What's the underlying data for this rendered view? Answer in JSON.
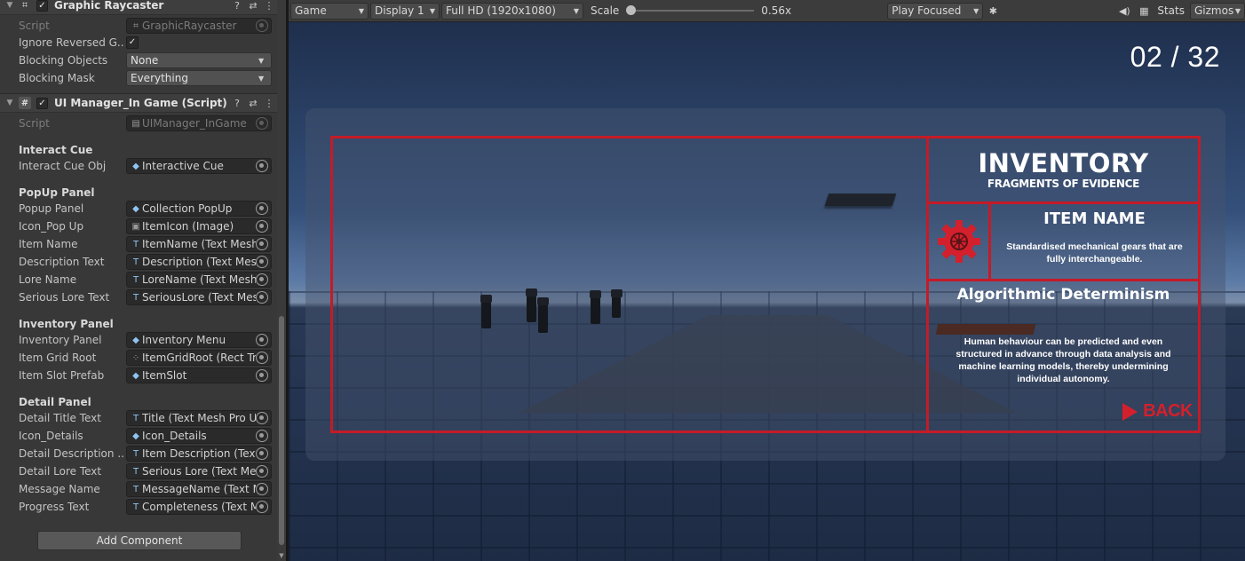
{
  "colors": {
    "accent_red": "#c41b27",
    "inspector_bg": "#383838",
    "object_icon": "#8fc4f2"
  },
  "inspector": {
    "graphic_raycaster": {
      "title": "Graphic Raycaster",
      "script_label": "Script",
      "script_value": "GraphicRaycaster",
      "ignore_reversed_label": "Ignore Reversed G...",
      "ignore_reversed_checked": "✓",
      "blocking_objects_label": "Blocking Objects",
      "blocking_objects_value": "None",
      "blocking_mask_label": "Blocking Mask",
      "blocking_mask_value": "Everything"
    },
    "ui_manager": {
      "title": "UI Manager_In Game (Script)",
      "enabled": "✓",
      "script_label": "Script",
      "script_value": "UIManager_InGame"
    },
    "sections": {
      "interact_cue": "Interact Cue",
      "popup_panel": "PopUp Panel",
      "inventory_panel": "Inventory Panel",
      "detail_panel": "Detail Panel"
    },
    "fields": {
      "interact_cue_obj": {
        "label": "Interact Cue Obj",
        "value": "Interactive Cue"
      },
      "popup_panel": {
        "label": "Popup Panel",
        "value": "Collection PopUp"
      },
      "icon_pop_up": {
        "label": "Icon_Pop Up",
        "value": "ItemIcon (Image)"
      },
      "item_name": {
        "label": "Item Name",
        "value": "ItemName (Text Mesh"
      },
      "description_text": {
        "label": "Description Text",
        "value": "Description (Text Mesh"
      },
      "lore_name": {
        "label": "Lore Name",
        "value": "LoreName (Text Mesh"
      },
      "serious_lore_text": {
        "label": "Serious Lore Text",
        "value": "SeriousLore (Text Mesh"
      },
      "inventory_panel": {
        "label": "Inventory Panel",
        "value": "Inventory Menu"
      },
      "item_grid_root": {
        "label": "Item Grid Root",
        "value": "ItemGridRoot (Rect Tra"
      },
      "item_slot_prefab": {
        "label": "Item Slot Prefab",
        "value": "ItemSlot"
      },
      "detail_title_text": {
        "label": "Detail Title Text",
        "value": "Title (Text Mesh Pro UG"
      },
      "icon_details": {
        "label": "Icon_Details",
        "value": "Icon_Details"
      },
      "detail_description": {
        "label": "Detail Description ...",
        "value": "Item Description (Text"
      },
      "detail_lore_text": {
        "label": "Detail Lore Text",
        "value": "Serious Lore (Text Mes"
      },
      "message_name": {
        "label": "Message Name",
        "value": "MessageName (Text M"
      },
      "progress_text": {
        "label": "Progress Text",
        "value": "Completeness (Text M"
      }
    },
    "add_component": "Add Component"
  },
  "game_toolbar": {
    "view": "Game",
    "display": "Display 1",
    "resolution": "Full HD (1920x1080)",
    "scale_label": "Scale",
    "scale_value": "0.56x",
    "scale_fraction": 0.0,
    "play_mode": "Play Focused",
    "stats": "Stats",
    "gizmos": "Gizmos"
  },
  "game_ui": {
    "progress_counter": "02 / 32",
    "inventory_title": "INVENTORY",
    "inventory_subtitle": "FRAGMENTS OF EVIDENCE",
    "item_name": "ITEM NAME",
    "item_description": "Standardised mechanical gears that are fully interchangeable.",
    "lore_title": "Algorithmic Determinism",
    "lore_text": "Human behaviour can be predicted and even structured in advance through data analysis and machine learning models, thereby undermining individual autonomy.",
    "back_label": "BACK"
  }
}
